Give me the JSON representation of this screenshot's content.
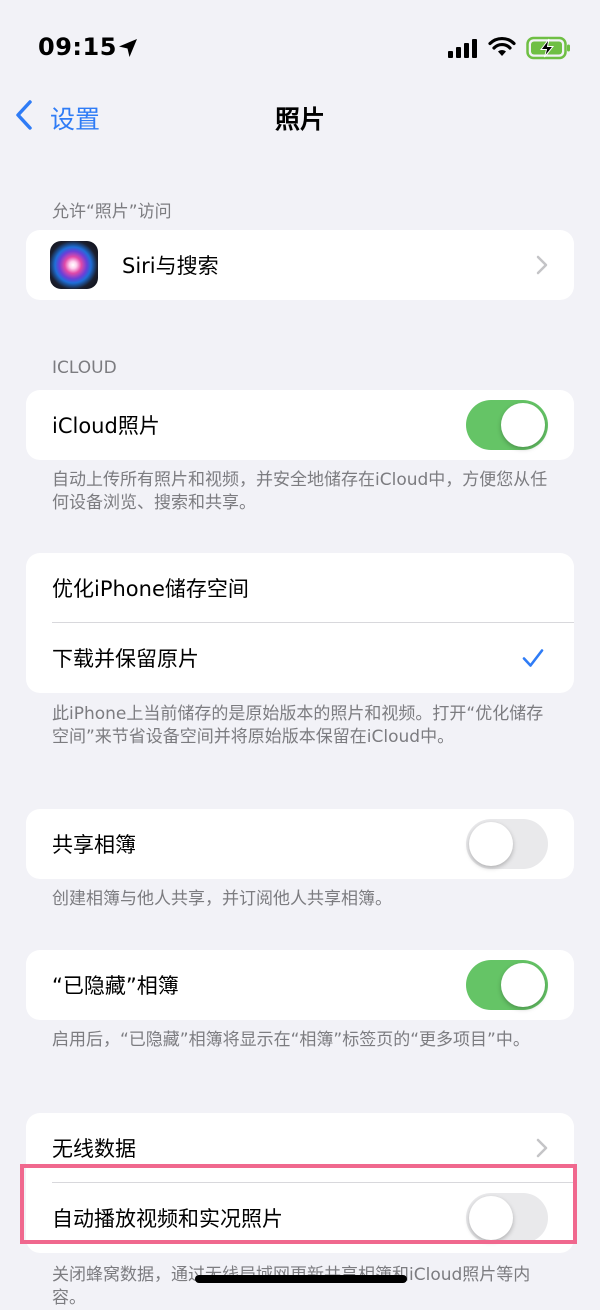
{
  "status_bar": {
    "time": "09:15"
  },
  "nav": {
    "back_label": "设置",
    "title": "照片"
  },
  "sections": {
    "access": {
      "header": "允许“照片”访问",
      "siri_label": "Siri与搜索"
    },
    "icloud": {
      "header": "ICLOUD",
      "icloud_photos_label": "iCloud照片",
      "icloud_photos_on": true,
      "icloud_photos_footer": "自动上传所有照片和视频，并安全地储存在iCloud中，方便您从任何设备浏览、搜索和共享。"
    },
    "storage": {
      "optimize_label": "优化iPhone储存空间",
      "download_label": "下载并保留原片",
      "selected": "download",
      "footer": "此iPhone上当前储存的是原始版本的照片和视频。打开“优化储存空间”来节省设备空间并将原始版本保留在iCloud中。"
    },
    "shared_albums": {
      "label": "共享相簿",
      "on": false,
      "footer": "创建相簿与他人共享，并订阅他人共享相簿。"
    },
    "hidden_album": {
      "label": "“已隐藏”相簿",
      "on": true,
      "footer": "启用后，“已隐藏”相簿将显示在“相簿”标签页的“更多项目”中。"
    },
    "wireless": {
      "cellular_label": "无线数据",
      "autoplay_label": "自动播放视频和实况照片",
      "autoplay_on": false,
      "footer": "关闭蜂窝数据，通过无线局域网更新共享相簿和iCloud照片等内容。"
    }
  },
  "colors": {
    "accent": "#2f7cf6",
    "toggle_on": "#65c466",
    "toggle_off": "#e9e9eb",
    "highlight": "#f0688e",
    "background": "#f2f2f7"
  }
}
